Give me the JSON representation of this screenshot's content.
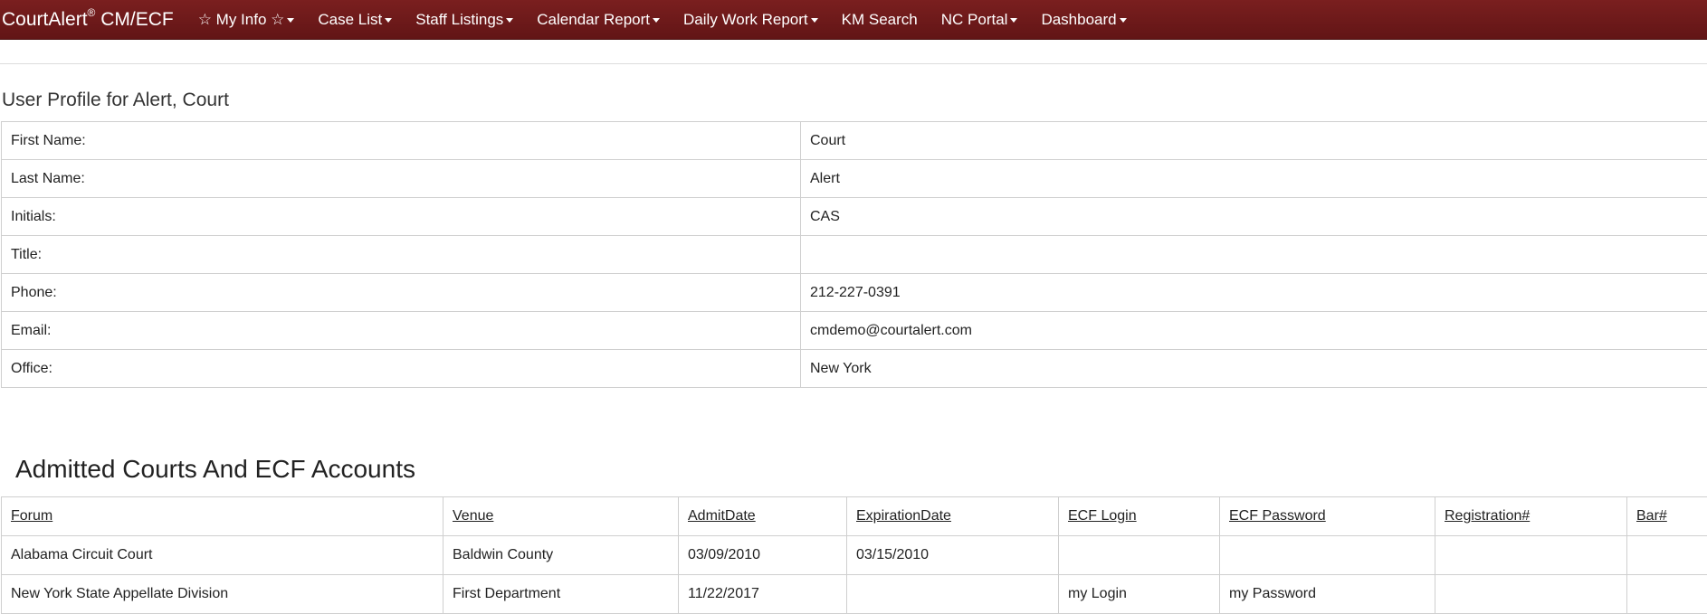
{
  "navbar": {
    "brand": "CourtAlert",
    "brand_reg": "®",
    "brand_suffix": " CM/ECF",
    "items": [
      {
        "label": "☆ My Info ☆"
      },
      {
        "label": "Case List"
      },
      {
        "label": "Staff Listings"
      },
      {
        "label": "Calendar Report"
      },
      {
        "label": "Daily Work Report"
      },
      {
        "label": "KM Search"
      },
      {
        "label": "NC Portal"
      },
      {
        "label": "Dashboard"
      }
    ]
  },
  "profile": {
    "heading": "User Profile for Alert, Court",
    "rows": [
      {
        "label": "First Name:",
        "value": "Court"
      },
      {
        "label": "Last Name:",
        "value": "Alert"
      },
      {
        "label": "Initials:",
        "value": "CAS"
      },
      {
        "label": "Title:",
        "value": ""
      },
      {
        "label": "Phone:",
        "value": "212-227-0391"
      },
      {
        "label": "Email:",
        "value": "cmdemo@courtalert.com"
      },
      {
        "label": "Office:",
        "value": "New York"
      }
    ]
  },
  "courts": {
    "heading": "Admitted Courts And ECF Accounts",
    "columns": [
      "Forum",
      "Venue",
      "AdmitDate",
      "ExpirationDate",
      "ECF Login",
      "ECF Password",
      "Registration#",
      "Bar#"
    ],
    "rows": [
      [
        "Alabama Circuit Court",
        "Baldwin County",
        "03/09/2010",
        "03/15/2010",
        "",
        "",
        "",
        ""
      ],
      [
        "New York State Appellate Division",
        "First Department",
        "11/22/2017",
        "",
        "my Login",
        "my Password",
        "",
        ""
      ]
    ]
  }
}
